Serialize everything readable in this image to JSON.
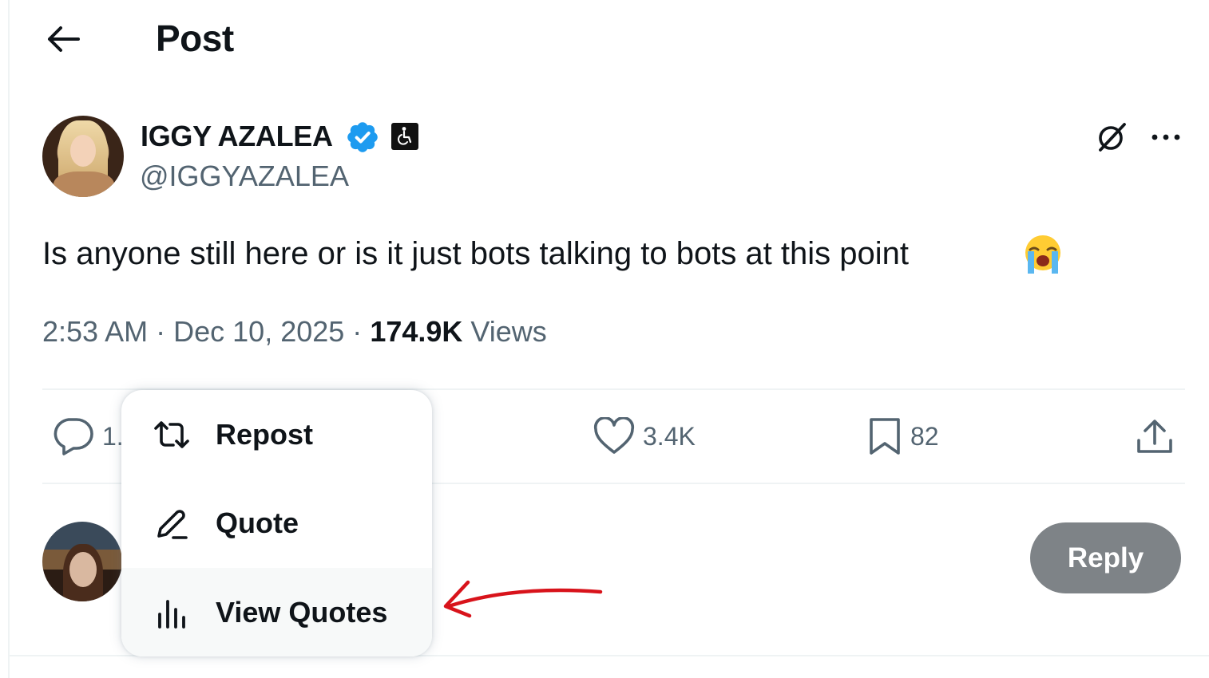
{
  "header": {
    "back_icon": "arrow-left-icon",
    "title": "Post"
  },
  "author": {
    "name": "IGGY AZALEA",
    "handle": "@IGGYAZALEA",
    "verified_icon": "verified-badge-icon",
    "affiliate_icon": "wheelchair-symbol-icon",
    "grok_icon": "grok-icon",
    "more_icon": "more-horizontal-icon"
  },
  "tweet": {
    "text": "Is anyone still here or is it just bots talking to bots at this point",
    "emoji": "loudly-crying-face-emoji"
  },
  "meta": {
    "time": "2:53 AM",
    "separator1": "·",
    "date": "Dec 10, 2025",
    "separator2": "·",
    "views_count": "174.9K",
    "views_label": "Views"
  },
  "actions": {
    "reply": {
      "icon": "comment-icon",
      "count": "1."
    },
    "like": {
      "icon": "heart-icon",
      "count": "3.4K"
    },
    "bookmark": {
      "icon": "bookmark-icon",
      "count": "82"
    },
    "share": {
      "icon": "share-icon"
    }
  },
  "menu": {
    "items": [
      {
        "label": "Repost",
        "icon": "repost-icon"
      },
      {
        "label": "Quote",
        "icon": "pencil-icon"
      },
      {
        "label": "View Quotes",
        "icon": "bar-chart-icon"
      }
    ]
  },
  "composer": {
    "reply_button": "Reply"
  },
  "colors": {
    "text_primary": "#0f1419",
    "text_secondary": "#536471",
    "verified_blue": "#1d9bf0",
    "reply_button_bg": "#7e8387",
    "annotation_red": "#d8131b"
  }
}
